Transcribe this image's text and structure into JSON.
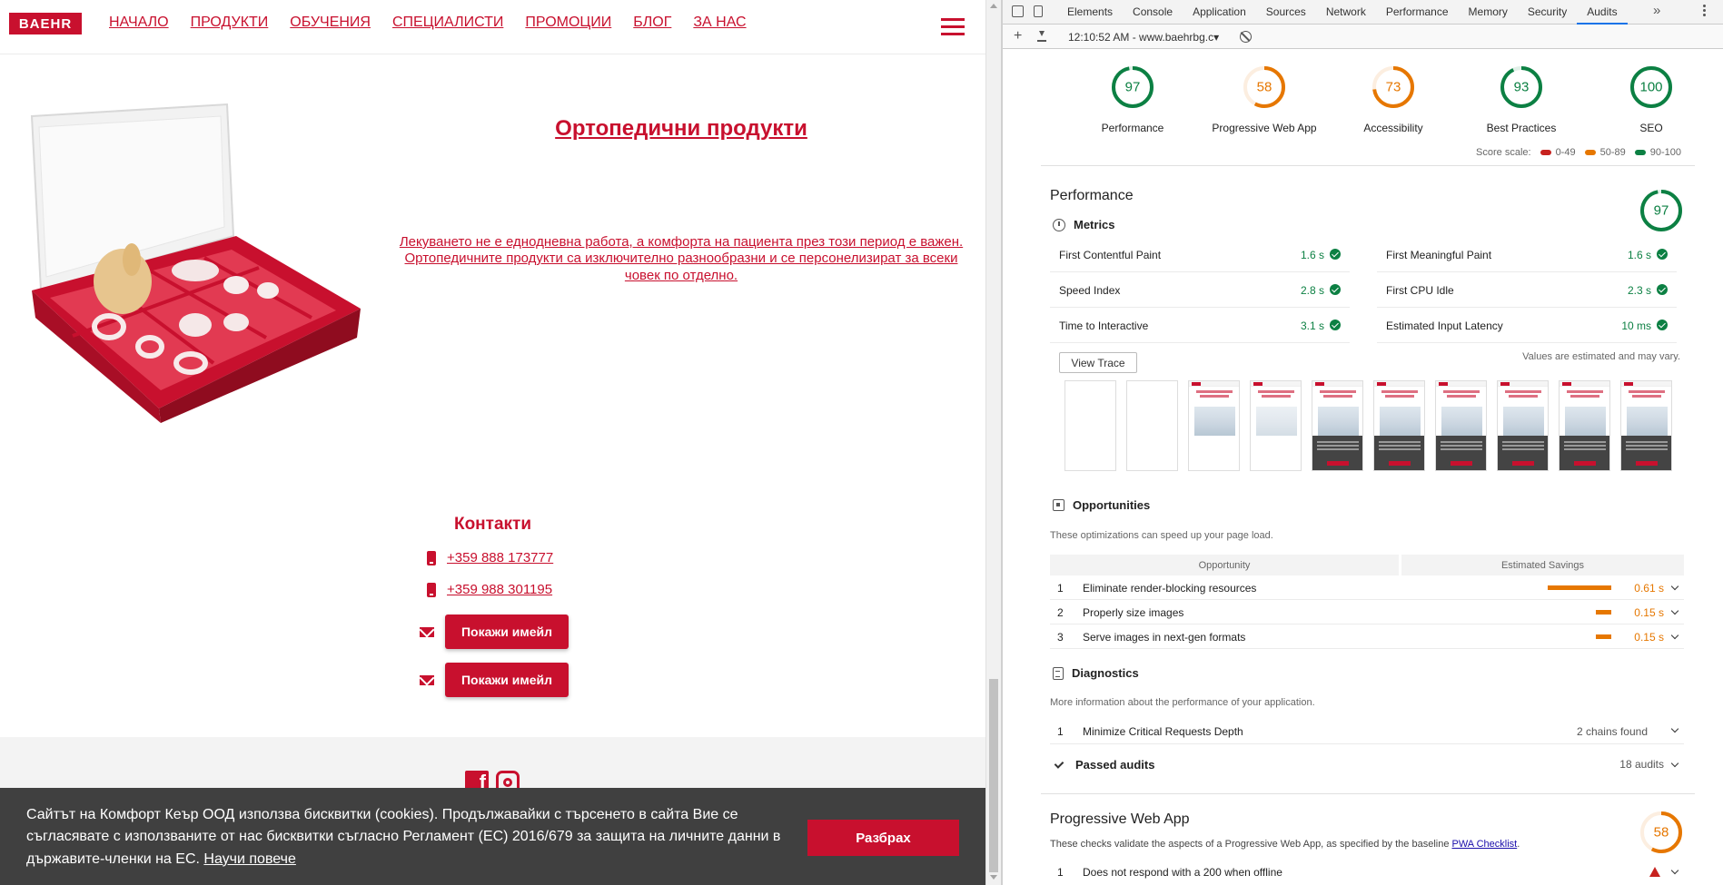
{
  "site": {
    "logo": "BAEHR",
    "nav": [
      "НАЧАЛО",
      "ПРОДУКТИ",
      "ОБУЧЕНИЯ",
      "СПЕЦИАЛИСТИ",
      "ПРОМОЦИИ",
      "БЛОГ",
      "ЗА НАС"
    ],
    "product": {
      "title": "Ортопедични продукти",
      "description": "Лекуването не е еднодневна работа, а комфорта на пациента през този период е важен. Ортопедичните продукти са изключително разнообразни и се персонелизират за всеки човек по отделно."
    },
    "contacts": {
      "title": "Контакти",
      "phones": [
        "+359 888 173777",
        "+359 988 301195"
      ],
      "email_buttons": [
        "Покажи имейл",
        "Покажи имейл"
      ]
    },
    "cookie": {
      "text": "Сайтът на Комфорт Кеър ООД използва бисквитки (cookies). Продължавайки с търсенето в сайта Вие се съгласявате с използваните от нас бисквитки съгласно Регламент (ЕС) 2016/679 за защита на личните данни в държавите-членки на ЕС.",
      "learn_more": "Научи повече",
      "accept": "Разбрах"
    }
  },
  "devtools": {
    "tabs": [
      "Elements",
      "Console",
      "Application",
      "Sources",
      "Network",
      "Performance",
      "Memory",
      "Security",
      "Audits"
    ],
    "active_tab": "Audits",
    "report_label": "12:10:52 AM - www.baehrbg.c▾",
    "categories": [
      {
        "label": "Performance",
        "score": 97,
        "score_text": "97",
        "color": "#0c8043"
      },
      {
        "label": "Progressive Web App",
        "score": 58,
        "score_text": "58",
        "color": "#e67700"
      },
      {
        "label": "Accessibility",
        "score": 73,
        "score_text": "73",
        "color": "#e67700"
      },
      {
        "label": "Best Practices",
        "score": 93,
        "score_text": "93",
        "color": "#0c8043"
      },
      {
        "label": "SEO",
        "score": 100,
        "score_text": "100",
        "color": "#0c8043"
      }
    ],
    "score_scale": {
      "label": "Score scale:",
      "ranges": [
        {
          "text": "0-49",
          "color": "#c7221f"
        },
        {
          "text": "50-89",
          "color": "#e67700"
        },
        {
          "text": "90-100",
          "color": "#0c8043"
        }
      ]
    },
    "performance": {
      "heading": "Performance",
      "score": 97,
      "score_text": "97",
      "metrics_heading": "Metrics",
      "metrics": [
        {
          "label": "First Contentful Paint",
          "value": "1.6 s"
        },
        {
          "label": "First Meaningful Paint",
          "value": "1.6 s"
        },
        {
          "label": "Speed Index",
          "value": "2.8 s"
        },
        {
          "label": "First CPU Idle",
          "value": "2.3 s"
        },
        {
          "label": "Time to Interactive",
          "value": "3.1 s"
        },
        {
          "label": "Estimated Input Latency",
          "value": "10 ms"
        }
      ],
      "view_trace": "View Trace",
      "values_estimated": "Values are estimated and may vary.",
      "opportunities_heading": "Opportunities",
      "opportunities_desc": "These optimizations can speed up your page load.",
      "opportunity_col": "Opportunity",
      "savings_col": "Estimated Savings",
      "opportunities": [
        {
          "num": "1",
          "title": "Eliminate render-blocking resources",
          "value": "0.61 s",
          "seconds": 0.61
        },
        {
          "num": "2",
          "title": "Properly size images",
          "value": "0.15 s",
          "seconds": 0.15
        },
        {
          "num": "3",
          "title": "Serve images in next-gen formats",
          "value": "0.15 s",
          "seconds": 0.15
        }
      ],
      "diagnostics_heading": "Diagnostics",
      "diagnostics_desc": "More information about the performance of your application.",
      "diagnostics": [
        {
          "num": "1",
          "title": "Minimize Critical Requests Depth",
          "value": "2 chains found"
        }
      ],
      "passed_heading": "Passed audits",
      "passed_count": "18 audits"
    },
    "pwa": {
      "heading": "Progressive Web App",
      "score": 58,
      "score_text": "58",
      "desc": "These checks validate the aspects of a Progressive Web App, as specified by the baseline",
      "link": "PWA Checklist",
      "desc_end": ".",
      "first_item": {
        "num": "1",
        "title": "Does not respond with a 200 when offline"
      }
    }
  }
}
